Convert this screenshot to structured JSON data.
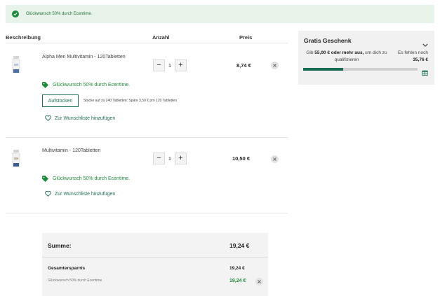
{
  "banner": {
    "text": "Glückwunsch 50% durch Ecentime."
  },
  "table": {
    "headers": {
      "description": "Beschreibung",
      "quantity": "Anzahl",
      "price": "Preis"
    }
  },
  "items": [
    {
      "name": "Alpha Men Multivitamin - 120Tabletten",
      "quantity": "1",
      "price": "8,74 €",
      "promo": "Glückwunsch 50% durch Ecentime.",
      "upsell_button": "Aufstocken",
      "upsell_text": "Stocke auf zu 240 Tabletten: Spare 3,50 € pro 120 Tabletten",
      "wishlist": "Zur Wunschliste hinzufügen"
    },
    {
      "name": "Multivitamin - 120Tabletten",
      "quantity": "1",
      "price": "10,50 €",
      "promo": "Glückwunsch 50% durch Ecentime.",
      "wishlist": "Zur Wunschliste hinzufügen"
    }
  ],
  "gift": {
    "title": "Gratis Geschenk",
    "msg_pre": "Gib ",
    "msg_amount": "55,00 € oder mehr aus,",
    "msg_post": " um dich zu qualifizieren",
    "remaining_label": "Es fehlen noch",
    "remaining_value": "35,76 €",
    "progress_fraction": 0.35
  },
  "summary": {
    "total_label": "Summe:",
    "total_value": "19,24 €",
    "savings_label": "Gesamtersparnis",
    "savings_value": "19,24 €",
    "discount_label": "Glückwunsch 50% durch Ecentime",
    "discount_value": "19,24 €"
  },
  "colors": {
    "accent": "#1f8a3b",
    "brand": "#146b52",
    "banner_bg": "#e8f3ea"
  }
}
